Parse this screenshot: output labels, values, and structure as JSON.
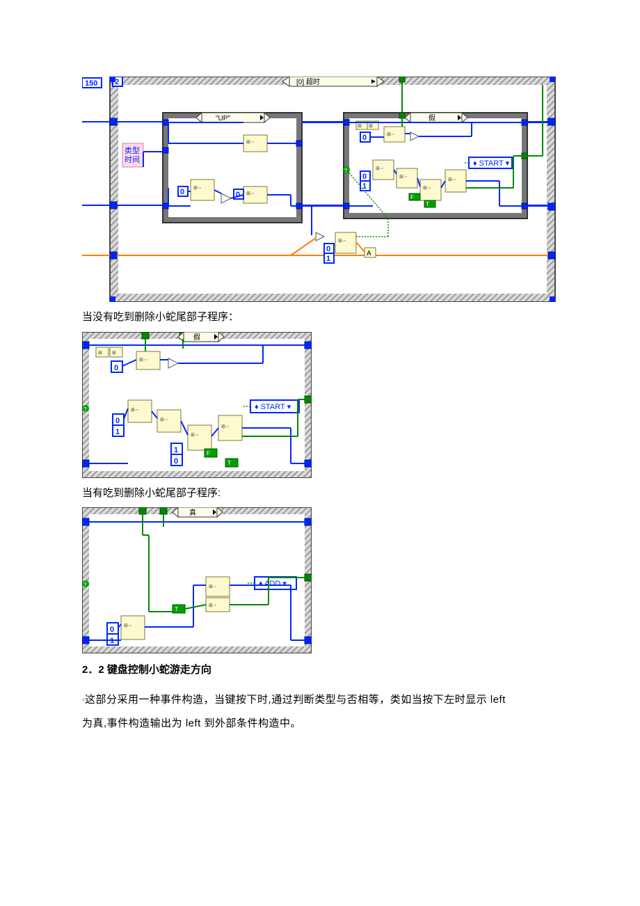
{
  "diagram1": {
    "loop_count": "150",
    "loop_i": "2",
    "event_selector": "[0] 超时",
    "node_label": "类型\n时间",
    "case_up_selector": "\"UP\"",
    "case_false_selector": "假",
    "const0_a": "0",
    "const0_b": "0",
    "const01_a": "0",
    "const01_b": "1",
    "local_start": "START",
    "const_A": "A"
  },
  "caption1": "当没有吃到删除小蛇尾部子程序：",
  "diagram2": {
    "case_selector": "假",
    "const0": "0",
    "const01_a": "0",
    "const01_b": "1",
    "local_start": "START"
  },
  "caption2": "当有吃到删除小蛇尾部子程序:",
  "diagram3": {
    "case_selector": "真",
    "const01_a": "0",
    "const01_b": "1",
    "local_add": "ADD"
  },
  "heading": "2．2 键盘控制小蛇游走方向",
  "para1_pref": "◦",
  "para1": "这部分采用一种事件构造，当键按下时,通过判断类型与否相等，类如当按下左时显示 left",
  "para2": "为真,事件构造输出为 left 到外部条件构造中。"
}
